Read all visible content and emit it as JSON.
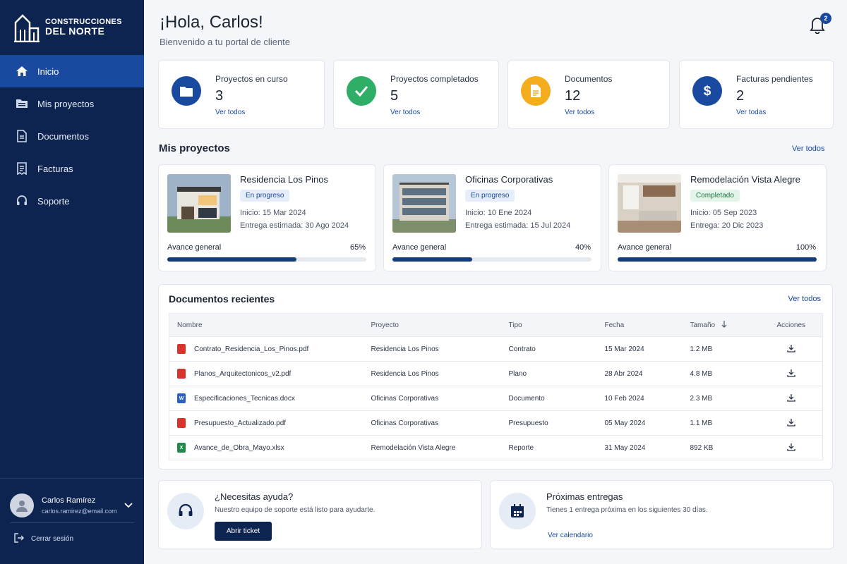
{
  "brand": {
    "line1": "CONSTRUCCIONES",
    "line2": "DEL NORTE"
  },
  "nav": [
    {
      "label": "Inicio",
      "icon": "home-icon",
      "active": true
    },
    {
      "label": "Mis proyectos",
      "icon": "folder-icon"
    },
    {
      "label": "Documentos",
      "icon": "document-icon"
    },
    {
      "label": "Facturas",
      "icon": "invoice-icon"
    },
    {
      "label": "Soporte",
      "icon": "headset-icon"
    }
  ],
  "user": {
    "name": "Carlos Ramírez",
    "email": "carlos.ramirez@email.com",
    "logout": "Cerrar sesión"
  },
  "header": {
    "greeting": "¡Hola, Carlos!",
    "subtitle": "Bienvenido a tu portal de cliente",
    "notifications": "2"
  },
  "stats": [
    {
      "label": "Proyectos en curso",
      "value": "3",
      "link": "Ver todos",
      "color": "#1a4aa0",
      "icon": "folder-icon"
    },
    {
      "label": "Proyectos completados",
      "value": "5",
      "link": "Ver todos",
      "color": "#2eae67",
      "icon": "check-icon"
    },
    {
      "label": "Documentos",
      "value": "12",
      "link": "Ver todos",
      "color": "#f4ad1e",
      "icon": "document-icon"
    },
    {
      "label": "Facturas pendientes",
      "value": "2",
      "link": "Ver todas",
      "color": "#1a4aa0",
      "icon": "dollar-icon"
    }
  ],
  "projects": {
    "title": "Mis proyectos",
    "link": "Ver todos",
    "items": [
      {
        "name": "Residencia Los Pinos",
        "status": "En progreso",
        "start_label": "Inicio:",
        "start": "15 Mar 2024",
        "end_label": "Entrega estimada:",
        "end": "30 Ago 2024",
        "progress_label": "Avance general",
        "progress_text": "65%",
        "progress": 0.65
      },
      {
        "name": "Oficinas Corporativas",
        "status": "En progreso",
        "start_label": "Inicio:",
        "start": "10 Ene 2024",
        "end_label": "Entrega estimada:",
        "end": "15 Jul 2024",
        "progress_label": "Avance general",
        "progress_text": "40%",
        "progress": 0.4
      },
      {
        "name": "Remodelación Vista Alegre",
        "status": "Completado",
        "start_label": "Inicio:",
        "start": "05 Sep 2023",
        "end_label": "Entrega:",
        "end": "20 Dic 2023",
        "progress_label": "Avance general",
        "progress_text": "100%",
        "progress": 1.0
      }
    ]
  },
  "documents": {
    "title": "Documentos recientes",
    "link": "Ver todos",
    "columns": [
      "Nombre",
      "Proyecto",
      "Tipo",
      "Fecha",
      "Tamaño",
      "Acciones"
    ],
    "rows": [
      {
        "name": "Contrato_Residencia_Los_Pinos.pdf",
        "filetype": "pdf",
        "project": "Residencia Los Pinos",
        "type": "Contrato",
        "date": "15 Mar 2024",
        "size": "1.2 MB"
      },
      {
        "name": "Planos_Arquitectonicos_v2.pdf",
        "filetype": "pdf",
        "project": "Residencia Los Pinos",
        "type": "Plano",
        "date": "28 Abr 2024",
        "size": "4.8 MB"
      },
      {
        "name": "Especificaciones_Tecnicas.docx",
        "filetype": "docx",
        "project": "Oficinas Corporativas",
        "type": "Documento",
        "date": "10 Feb 2024",
        "size": "2.3 MB"
      },
      {
        "name": "Presupuesto_Actualizado.pdf",
        "filetype": "pdf",
        "project": "Oficinas Corporativas",
        "type": "Presupuesto",
        "date": "05 May 2024",
        "size": "1.1 MB"
      },
      {
        "name": "Avance_de_Obra_Mayo.xlsx",
        "filetype": "xlsx",
        "project": "Remodelación Vista Alegre",
        "type": "Reporte",
        "date": "31 May 2024",
        "size": "892 KB"
      }
    ]
  },
  "help": {
    "title": "¿Necesitas ayuda?",
    "text": "Nuestro equipo de soporte está listo para ayudarte.",
    "button": "Abrir ticket"
  },
  "deliveries": {
    "title": "Próximas entregas",
    "text": "Tienes 1 entrega próxima en los siguientes 30 días.",
    "link": "Ver calendario"
  },
  "colors": {
    "sidebar": "#0d2350",
    "accent": "#1a4aa0",
    "pdf": "#d9342b",
    "docx": "#2b5fc2",
    "xlsx": "#1f8a4c"
  }
}
